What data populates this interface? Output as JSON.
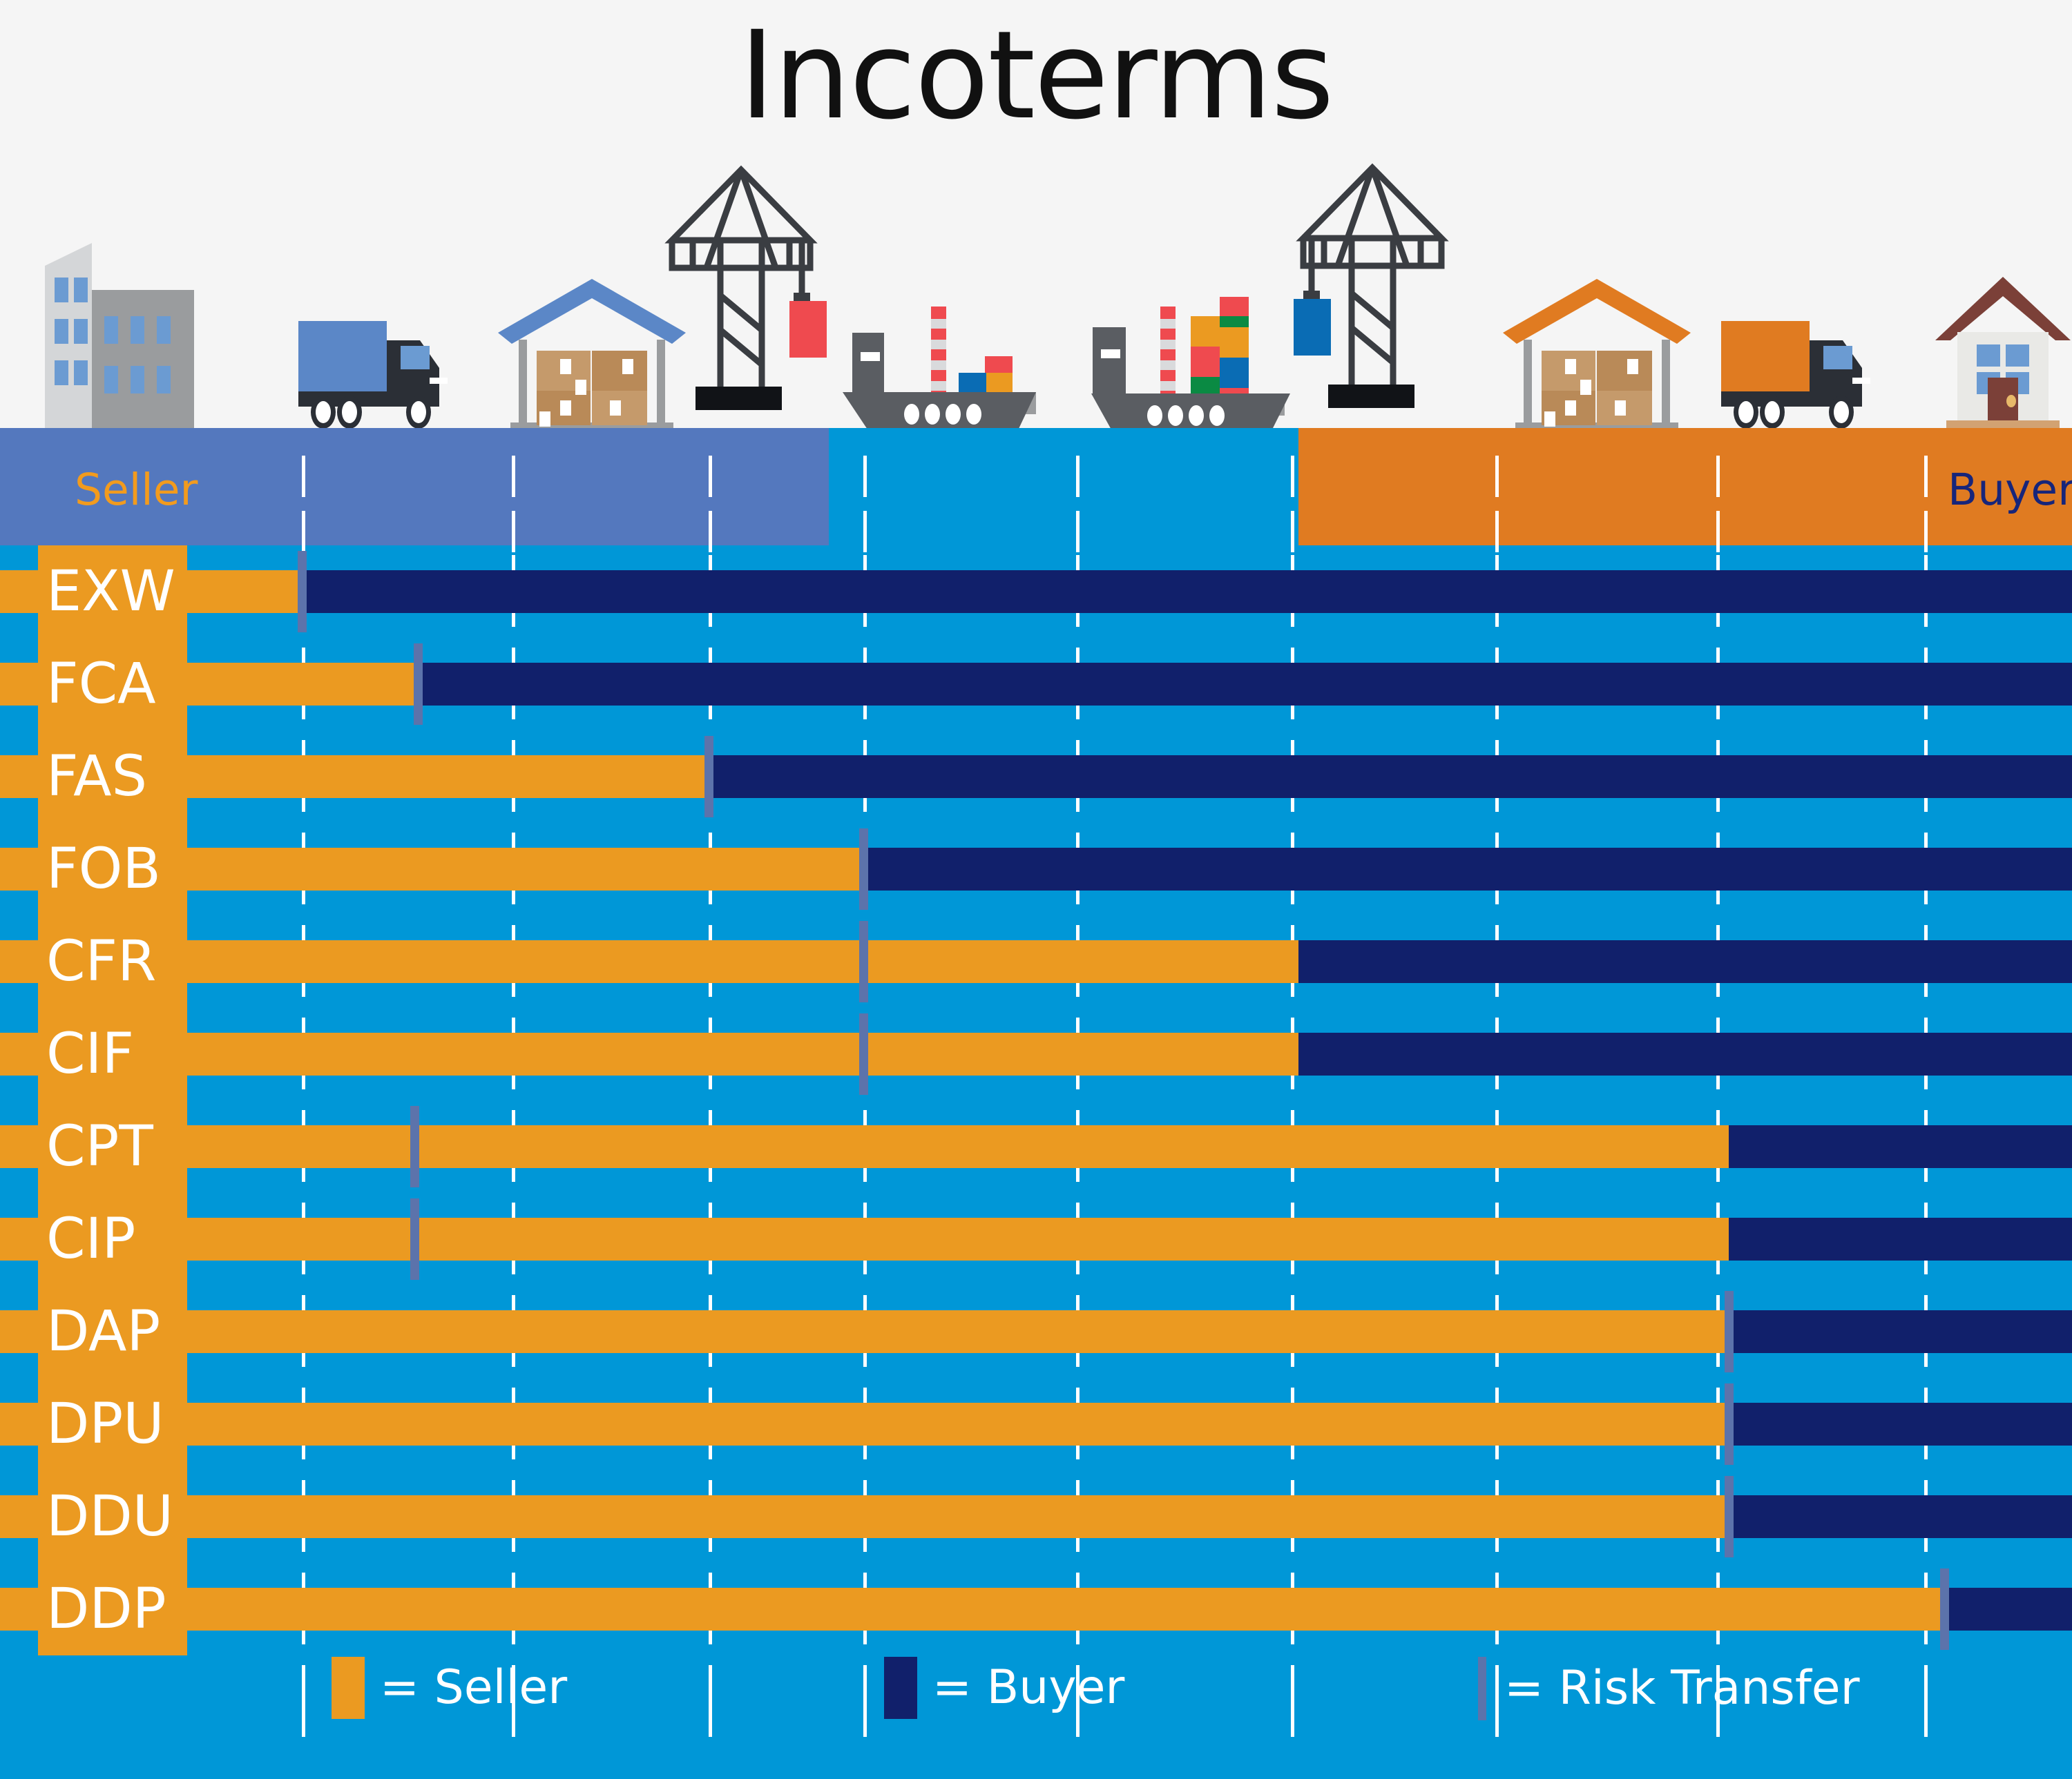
{
  "title": "Incoterms",
  "bands": {
    "seller_label": "Seller",
    "buyer_label": "Buyer"
  },
  "legend": {
    "seller": "= Seller",
    "buyer": "= Buyer",
    "risk": "= Risk Transfer"
  },
  "colors": {
    "seller_orange": "#eb9a21",
    "buyer_navy": "#11206b",
    "sea_blue": "#0097d7",
    "seller_band_blue": "#5478be",
    "buyer_band_orange": "#e07b21",
    "risk_marker": "#5c73ab",
    "background": "#f5f5f5",
    "title_text": "#111111",
    "gridline": "#ffffff"
  },
  "icons": [
    "factory-buildings-icon",
    "seller-truck-icon",
    "seller-warehouse-icon",
    "port-crane-origin-icon",
    "container-ship-origin-icon",
    "container-ship-destination-icon",
    "port-crane-destination-icon",
    "buyer-warehouse-icon",
    "buyer-truck-icon",
    "buyer-house-icon"
  ],
  "chart_data": {
    "type": "bar",
    "title": "Incoterms",
    "xlabel": "",
    "ylabel": "",
    "orientation": "horizontal",
    "stacked": true,
    "xlim": [
      0,
      3000
    ],
    "grid": true,
    "legend_position": "bottom",
    "series": [
      {
        "name": "= Seller",
        "color": "#eb9a21"
      },
      {
        "name": "= Buyer",
        "color": "#11206b"
      },
      {
        "name": "= Risk Transfer",
        "color": "#5c73ab"
      }
    ],
    "gridline_x": [
      437,
      741,
      1026,
      1250,
      1558,
      1869,
      2165,
      2485,
      2786
    ],
    "categories": [
      "EXW",
      "FCA",
      "FAS",
      "FOB",
      "CFR",
      "CIF",
      "CPT",
      "CIP",
      "DAP",
      "DPU",
      "DDU",
      "DDP"
    ],
    "rows": [
      {
        "term": "EXW",
        "seller_end": 437,
        "risk_x": 437
      },
      {
        "term": "FCA",
        "seller_end": 605,
        "risk_x": 605
      },
      {
        "term": "FAS",
        "seller_end": 1026,
        "risk_x": 1026
      },
      {
        "term": "FOB",
        "seller_end": 1250,
        "risk_x": 1250
      },
      {
        "term": "CFR",
        "seller_end": 1880,
        "risk_x": 1250
      },
      {
        "term": "CIF",
        "seller_end": 1880,
        "risk_x": 1250
      },
      {
        "term": "CPT",
        "seller_end": 2503,
        "risk_x": 600
      },
      {
        "term": "CIP",
        "seller_end": 2503,
        "risk_x": 600
      },
      {
        "term": "DAP",
        "seller_end": 2503,
        "risk_x": 2503
      },
      {
        "term": "DPU",
        "seller_end": 2503,
        "risk_x": 2503
      },
      {
        "term": "DDU",
        "seller_end": 2503,
        "risk_x": 2503
      },
      {
        "term": "DDP",
        "seller_end": 2815,
        "risk_x": 2815
      }
    ]
  }
}
